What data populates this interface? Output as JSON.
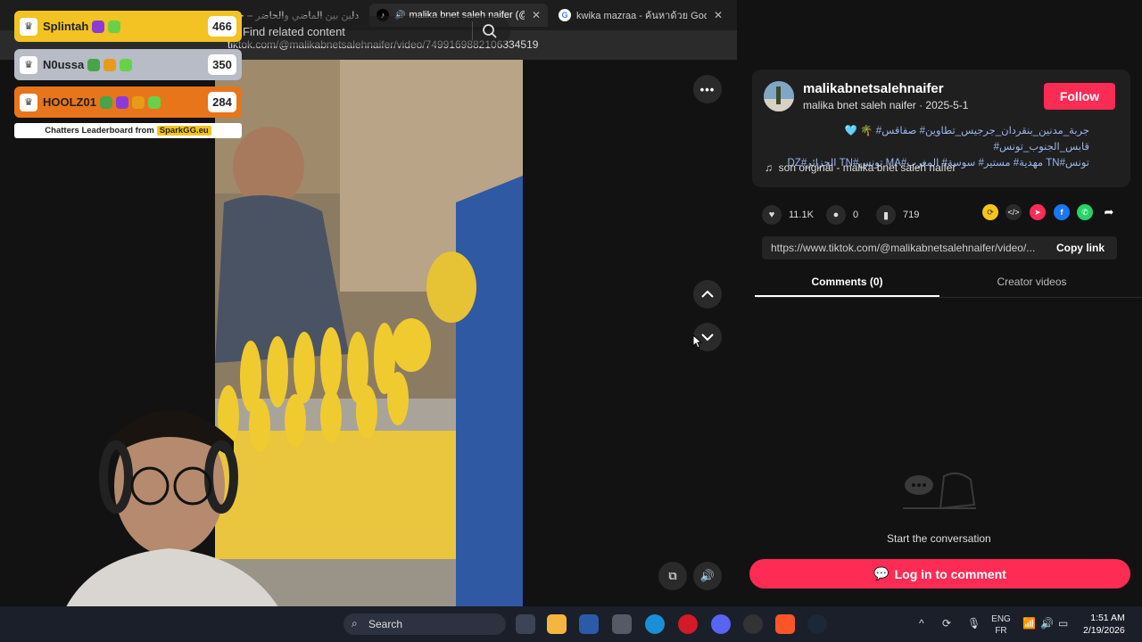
{
  "browser": {
    "tabs": [
      {
        "label": "مدلين بين الماضي والحاضر – حي...",
        "active": false
      },
      {
        "label": "malika bnet saleh naifer (@m...",
        "active": true
      },
      {
        "label": "kwika mazraa - ค้นหาด้วย Google",
        "active": false
      }
    ],
    "url": "tiktok.com/@malikabnetsalehnaifer/video/7499169882106334519"
  },
  "video": {
    "search_placeholder": "Find related content"
  },
  "post": {
    "username": "malikabnetsalehnaifer",
    "nickname": "malika bnet saleh naifer",
    "date": "2025-5-1",
    "follow_label": "Follow",
    "hashtags_line1": "جربة_مدنين_بنقردان_جرجيس_تطاوين# صفاقس# 🌴 🩵قابس_الجنوب_تونس#",
    "hashtags_line2": "تونس#TN مهدية# مستير# سوسة# المغرب#MA تونس#TN الجزائر#DZ",
    "sound": "son original - malika bnet saleh naifer",
    "likes": "11.1K",
    "comments": "0",
    "saves": "719",
    "link": "https://www.tiktok.com/@malikabnetsalehnaifer/video/...",
    "copy_label": "Copy link",
    "tab_comments": "Comments (0)",
    "tab_creator": "Creator videos",
    "empty_text": "Start the conversation",
    "login_label": "Log in to comment"
  },
  "leaderboard": {
    "rows": [
      {
        "name": "Splintah",
        "score": "466",
        "color": "#f2c322"
      },
      {
        "name": "N0ussa",
        "score": "350",
        "color": "#b7bcc6"
      },
      {
        "name": "HOOLZ01",
        "score": "284",
        "color": "#e8751a"
      }
    ],
    "footer": "Chatters Leaderboard from",
    "brand": "SparkGG.eu"
  },
  "taskbar": {
    "search": "Search",
    "lang1": "ENG",
    "lang2": "FR",
    "time": "1:51 AM",
    "date": "2/19/2026"
  },
  "colors": {
    "accent": "#fe2c55",
    "hashtag": "#9ab6ef"
  }
}
